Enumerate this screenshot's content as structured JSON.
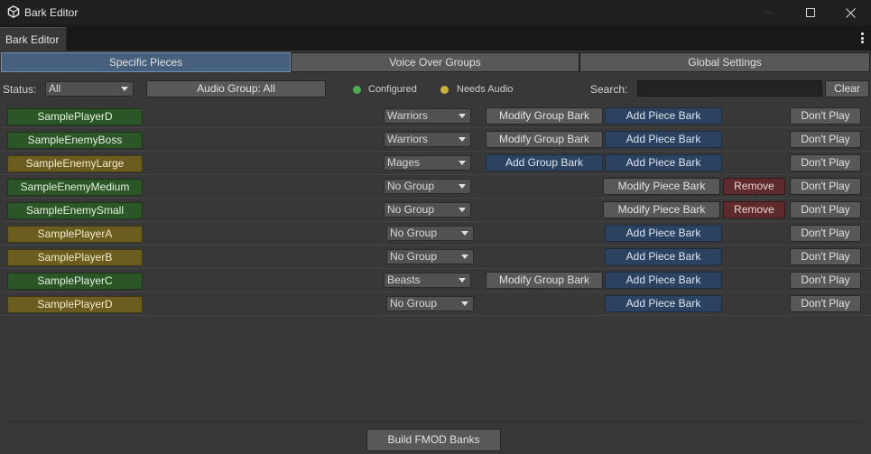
{
  "window": {
    "title": "Bark Editor",
    "icon": "app-cube-icon"
  },
  "tab": {
    "label": "Bark Editor"
  },
  "main_tabs": [
    {
      "label": "Specific Pieces",
      "active": true
    },
    {
      "label": "Voice Over Groups",
      "active": false
    },
    {
      "label": "Global Settings",
      "active": false
    }
  ],
  "filters": {
    "status_label": "Status:",
    "status_value": "All",
    "audio_group_button": "Audio Group: All",
    "legend_configured": "Configured",
    "legend_needs_audio": "Needs Audio",
    "search_label": "Search:",
    "search_value": "",
    "clear_button": "Clear"
  },
  "colors": {
    "configured": "#4fae4f",
    "needs_audio": "#c9ad3d",
    "active_tab": "#46607e",
    "blue_button": "#2c4261",
    "red_button": "#5f2a2c"
  },
  "pieces": [
    {
      "name": "SamplePlayerD",
      "status": "configured",
      "group": "Warriors",
      "group_action": "Modify Group Bark",
      "piece_action": "Add Piece Bark",
      "remove": "",
      "dont_play": "Don't Play"
    },
    {
      "name": "SampleEnemyBoss",
      "status": "configured",
      "group": "Warriors",
      "group_action": "Modify Group Bark",
      "piece_action": "Add Piece Bark",
      "remove": "",
      "dont_play": "Don't Play"
    },
    {
      "name": "SampleEnemyLarge",
      "status": "needs_audio",
      "group": "Mages",
      "group_action": "Add Group Bark",
      "piece_action": "Add Piece Bark",
      "remove": "",
      "dont_play": "Don't Play"
    },
    {
      "name": "SampleEnemyMedium",
      "status": "configured",
      "group": "No Group",
      "group_action": "",
      "piece_action": "Modify Piece Bark",
      "remove": "Remove",
      "dont_play": "Don't Play"
    },
    {
      "name": "SampleEnemySmall",
      "status": "configured",
      "group": "No Group",
      "group_action": "",
      "piece_action": "Modify Piece Bark",
      "remove": "Remove",
      "dont_play": "Don't Play"
    },
    {
      "name": "SamplePlayerA",
      "status": "needs_audio",
      "group": "No Group",
      "group_action": "",
      "piece_action": "Add Piece Bark",
      "remove": "",
      "dont_play": "Don't Play"
    },
    {
      "name": "SamplePlayerB",
      "status": "needs_audio",
      "group": "No Group",
      "group_action": "",
      "piece_action": "Add Piece Bark",
      "remove": "",
      "dont_play": "Don't Play"
    },
    {
      "name": "SamplePlayerC",
      "status": "configured",
      "group": "Beasts",
      "group_action": "Modify Group Bark",
      "piece_action": "Add Piece Bark",
      "remove": "",
      "dont_play": "Don't Play"
    },
    {
      "name": "SamplePlayerD",
      "status": "needs_audio",
      "group": "No Group",
      "group_action": "",
      "piece_action": "Add Piece Bark",
      "remove": "",
      "dont_play": "Don't Play"
    }
  ],
  "footer": {
    "build_button": "Build FMOD Banks"
  }
}
